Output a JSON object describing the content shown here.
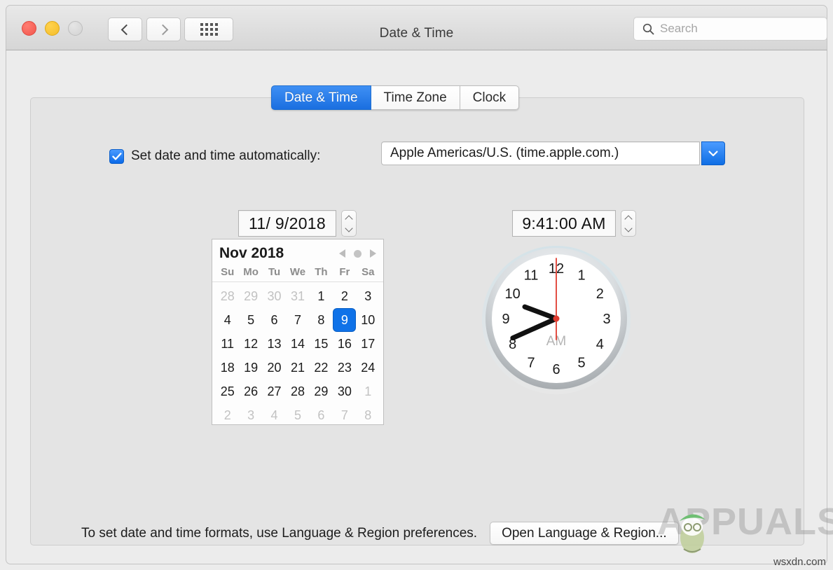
{
  "window": {
    "title": "Date & Time",
    "traffic_lights": [
      "close",
      "minimize",
      "zoom"
    ],
    "nav_back": "back",
    "nav_forward": "forward",
    "show_all": "show-all-grid"
  },
  "search": {
    "value": "",
    "placeholder": "Search"
  },
  "tabs": [
    {
      "label": "Date & Time",
      "active": true
    },
    {
      "label": "Time Zone",
      "active": false
    },
    {
      "label": "Clock",
      "active": false
    }
  ],
  "auto_row": {
    "checked": true,
    "label": "Set date and time automatically:",
    "server": "Apple Americas/U.S. (time.apple.com.)"
  },
  "date_field": {
    "value": "11/  9/2018"
  },
  "time_field": {
    "value": "9:41:00 AM"
  },
  "calendar": {
    "month_label": "Nov 2018",
    "weekdays": [
      "Su",
      "Mo",
      "Tu",
      "We",
      "Th",
      "Fr",
      "Sa"
    ],
    "selected_day": 9,
    "weeks": [
      [
        {
          "d": "28",
          "muted": true
        },
        {
          "d": "29",
          "muted": true
        },
        {
          "d": "30",
          "muted": true
        },
        {
          "d": "31",
          "muted": true
        },
        {
          "d": "1"
        },
        {
          "d": "2"
        },
        {
          "d": "3"
        }
      ],
      [
        {
          "d": "4"
        },
        {
          "d": "5"
        },
        {
          "d": "6"
        },
        {
          "d": "7"
        },
        {
          "d": "8"
        },
        {
          "d": "9",
          "sel": true
        },
        {
          "d": "10"
        }
      ],
      [
        {
          "d": "11"
        },
        {
          "d": "12"
        },
        {
          "d": "13"
        },
        {
          "d": "14"
        },
        {
          "d": "15"
        },
        {
          "d": "16"
        },
        {
          "d": "17"
        }
      ],
      [
        {
          "d": "18"
        },
        {
          "d": "19"
        },
        {
          "d": "20"
        },
        {
          "d": "21"
        },
        {
          "d": "22"
        },
        {
          "d": "23"
        },
        {
          "d": "24"
        }
      ],
      [
        {
          "d": "25"
        },
        {
          "d": "26"
        },
        {
          "d": "27"
        },
        {
          "d": "28"
        },
        {
          "d": "29"
        },
        {
          "d": "30"
        },
        {
          "d": "1",
          "muted": true
        }
      ],
      [
        {
          "d": "2",
          "muted": true
        },
        {
          "d": "3",
          "muted": true
        },
        {
          "d": "4",
          "muted": true
        },
        {
          "d": "5",
          "muted": true
        },
        {
          "d": "6",
          "muted": true
        },
        {
          "d": "7",
          "muted": true
        },
        {
          "d": "8",
          "muted": true
        }
      ]
    ]
  },
  "clock": {
    "hours": [
      "12",
      "1",
      "2",
      "3",
      "4",
      "5",
      "6",
      "7",
      "8",
      "9",
      "10",
      "11"
    ],
    "meridiem": "AM",
    "hour_value": 9,
    "minute_value": 41,
    "second_value": 0,
    "second_hand_color": "#e03b2f"
  },
  "footer": {
    "note": "To set date and time formats, use Language & Region preferences.",
    "button": "Open Language & Region..."
  },
  "watermark": {
    "text": "APPUALS",
    "site": "wsxdn.com"
  },
  "colors": {
    "accent": "#0f72e8",
    "tab_active": "#1a6fe0",
    "panel": "#e4e4e4",
    "chrome": "#ececec"
  }
}
